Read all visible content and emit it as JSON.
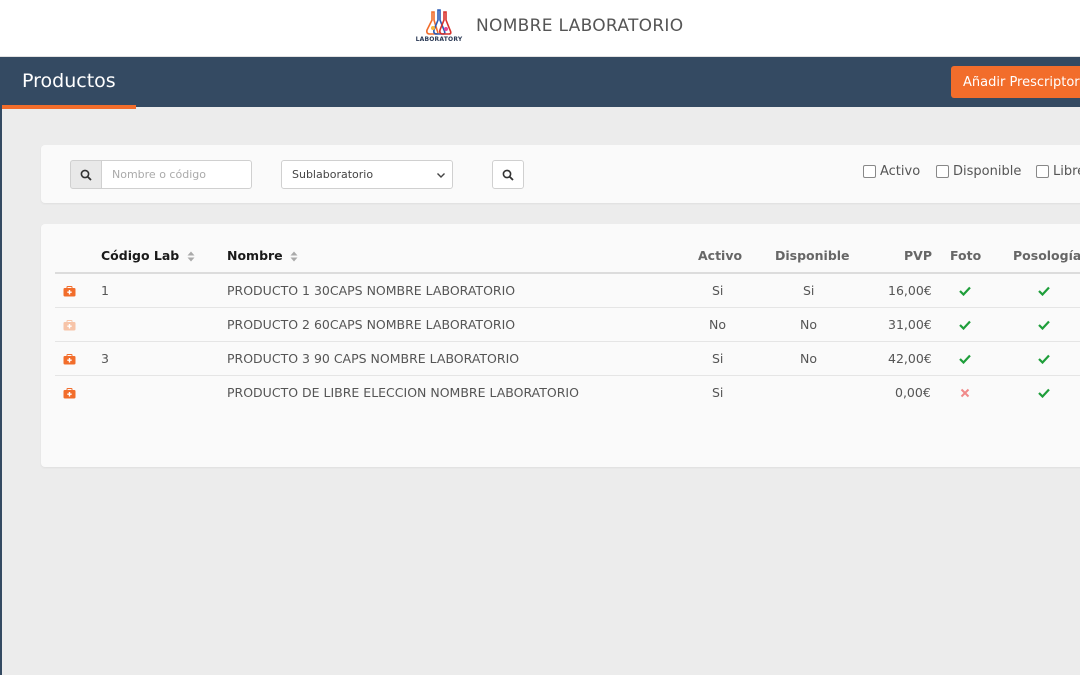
{
  "header": {
    "logo_text": "LABORATORY",
    "lab_name": "NOMBRE LABORATORIO"
  },
  "titlebar": {
    "title": "Productos",
    "add_button": "Añadir Prescriptor"
  },
  "filters": {
    "search_placeholder": "Nombre o código",
    "sublab_selected": "Sublaboratorio",
    "checkboxes": [
      "Activo",
      "Disponible",
      "Libre"
    ]
  },
  "table": {
    "columns": [
      "Código Lab",
      "Nombre",
      "Activo",
      "Disponible",
      "PVP",
      "Foto",
      "Posología"
    ],
    "rows": [
      {
        "codigo": "1",
        "nombre": "PRODUCTO 1 30CAPS NOMBRE LABORATORIO",
        "activo": "Si",
        "disponible": "Si",
        "pvp": "16,00€",
        "foto": "check",
        "posologia": "check",
        "icon_faded": false
      },
      {
        "codigo": "",
        "nombre": "PRODUCTO 2 60CAPS NOMBRE LABORATORIO",
        "activo": "No",
        "disponible": "No",
        "pvp": "31,00€",
        "foto": "check",
        "posologia": "check",
        "icon_faded": true
      },
      {
        "codigo": "3",
        "nombre": "PRODUCTO 3 90 CAPS NOMBRE LABORATORIO",
        "activo": "Si",
        "disponible": "No",
        "pvp": "42,00€",
        "foto": "check",
        "posologia": "check",
        "icon_faded": false
      },
      {
        "codigo": "",
        "nombre": "PRODUCTO DE LIBRE ELECCION NOMBRE LABORATORIO",
        "activo": "Si",
        "disponible": "",
        "pvp": "0,00€",
        "foto": "cross",
        "posologia": "check",
        "icon_faded": false
      }
    ]
  },
  "colors": {
    "accent": "#f26d2b",
    "navbar": "#344a62",
    "check": "#1e9e3a",
    "cross": "#f08a8a"
  }
}
